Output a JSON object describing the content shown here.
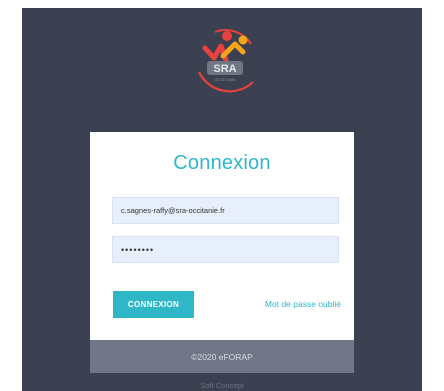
{
  "brand": {
    "logo_text": "SRA",
    "logo_subtext": "OCCITANIE"
  },
  "login": {
    "title": "Connexion",
    "email_value": "c.sagnes-raffy@sra-occitanie.fr",
    "password_value": "••••••••",
    "submit_label": "CONNEXION",
    "forgot_label": "Mot de passe oublié"
  },
  "footer": {
    "copyright": "©2020 eFORAP"
  },
  "credit": {
    "label": "Soft Concept"
  },
  "colors": {
    "background": "#3b4150",
    "accent": "#2fb7c8",
    "footer": "#717786"
  }
}
